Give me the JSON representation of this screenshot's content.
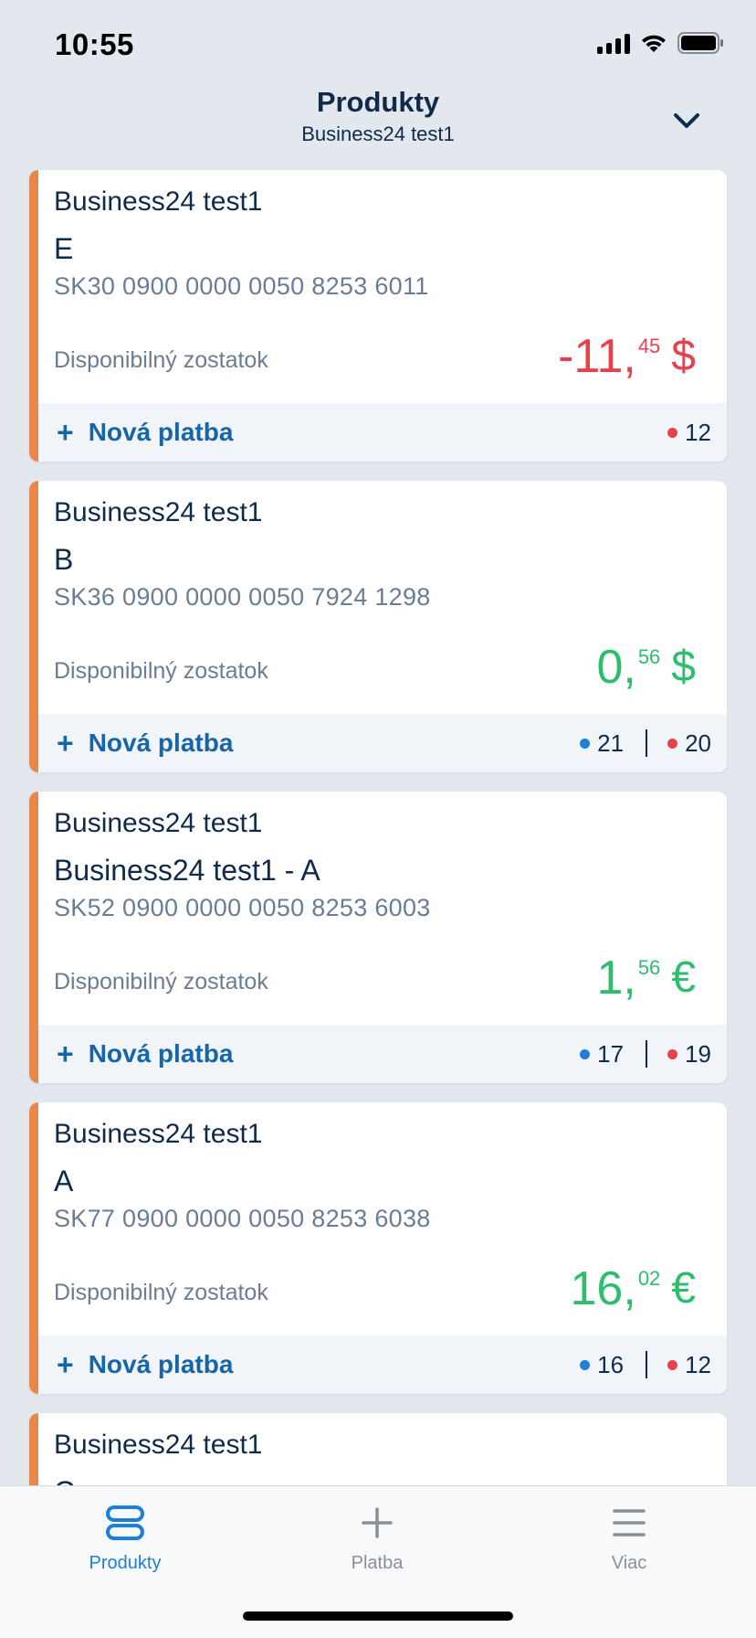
{
  "status_bar": {
    "time": "10:55"
  },
  "header": {
    "title": "Produkty",
    "subtitle": "Business24 test1"
  },
  "common": {
    "balance_label": "Disponibilný zostatok",
    "new_payment_label": "Nová platba"
  },
  "accounts": [
    {
      "owner": "Business24 test1",
      "name": "E",
      "iban": "SK30 0900 0000 0050 8253 6011",
      "amount_int": "-11,",
      "amount_dec": "45",
      "currency": "$",
      "sign": "negative",
      "blue_count": null,
      "red_count": "12"
    },
    {
      "owner": "Business24 test1",
      "name": "B",
      "iban": "SK36 0900 0000 0050 7924 1298",
      "amount_int": "0,",
      "amount_dec": "56",
      "currency": "$",
      "sign": "positive",
      "blue_count": "21",
      "red_count": "20"
    },
    {
      "owner": "Business24 test1",
      "name": "Business24 test1 - A",
      "iban": "SK52 0900 0000 0050 8253 6003",
      "amount_int": "1,",
      "amount_dec": "56",
      "currency": "€",
      "sign": "positive",
      "blue_count": "17",
      "red_count": "19"
    },
    {
      "owner": "Business24 test1",
      "name": "A",
      "iban": "SK77 0900 0000 0050 8253 6038",
      "amount_int": "16,",
      "amount_dec": "02",
      "currency": "€",
      "sign": "positive",
      "blue_count": "16",
      "red_count": "12"
    },
    {
      "owner": "Business24 test1",
      "name": "C"
    }
  ],
  "tabbar": {
    "tabs": [
      {
        "label": "Produkty",
        "icon": "products-icon",
        "active": true
      },
      {
        "label": "Platba",
        "icon": "plus-icon",
        "active": false
      },
      {
        "label": "Viac",
        "icon": "menu-icon",
        "active": false
      }
    ]
  },
  "colors": {
    "accent": "#e8874a",
    "negative": "#e8414b",
    "positive": "#2dbd6e",
    "link": "#1565a8",
    "tab_active": "#1e7fd8"
  }
}
